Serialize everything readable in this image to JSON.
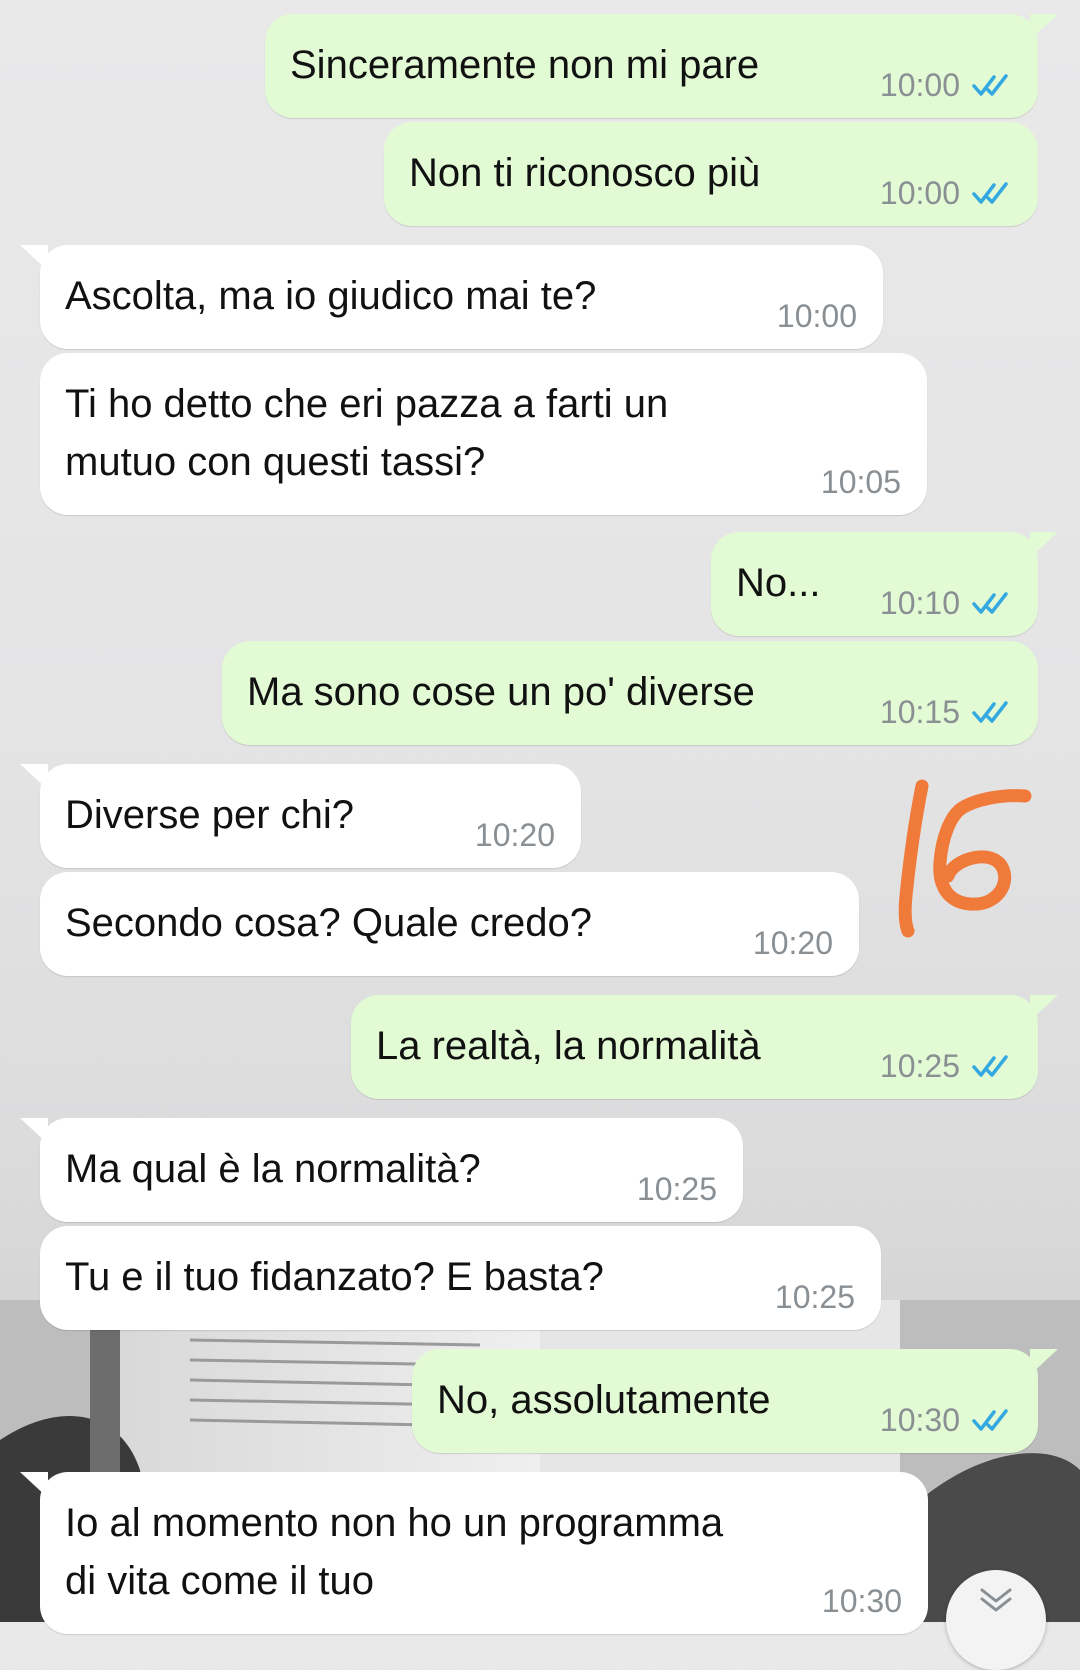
{
  "chat": {
    "messages": [
      {
        "direction": "out",
        "text": "Sinceramente non mi pare",
        "time": "10:00",
        "status": "read-icon"
      },
      {
        "direction": "out",
        "text": "Non ti riconosco più",
        "time": "10:00",
        "status": "read-icon"
      },
      {
        "direction": "in",
        "text": "Ascolta, ma io giudico mai te?",
        "time": "10:00"
      },
      {
        "direction": "in",
        "text": "Ti ho detto che eri pazza a farti un\nmutuo con questi tassi?",
        "time": "10:05"
      },
      {
        "direction": "out",
        "text": "No...",
        "time": "10:10",
        "status": "read-icon"
      },
      {
        "direction": "out",
        "text": "Ma sono cose un po' diverse",
        "time": "10:15",
        "status": "read-icon"
      },
      {
        "direction": "in",
        "text": "Diverse per chi?",
        "time": "10:20"
      },
      {
        "direction": "in",
        "text": "Secondo cosa? Quale credo?",
        "time": "10:20"
      },
      {
        "direction": "out",
        "text": "La realtà, la normalità",
        "time": "10:25",
        "status": "read-icon"
      },
      {
        "direction": "in",
        "text": "Ma qual è la normalità?",
        "time": "10:25"
      },
      {
        "direction": "in",
        "text": "Tu e il tuo fidanzato? E basta?",
        "time": "10:25"
      },
      {
        "direction": "out",
        "text": "No, assolutamente",
        "time": "10:30",
        "status": "read-icon"
      },
      {
        "direction": "in",
        "text": "Io al momento non ho un programma\ndi vita come il tuo",
        "time": "10:30"
      }
    ]
  },
  "annotation": {
    "text": "L6",
    "color": "#f07a3a"
  },
  "colors": {
    "outgoing_bubble": "#e2fbd4",
    "incoming_bubble": "#ffffff",
    "read_ticks": "#34a8e0",
    "timestamp": "#8a8f93"
  },
  "icons": {
    "read_receipt": "double-check-icon",
    "scroll_down": "chevron-down-icon"
  }
}
